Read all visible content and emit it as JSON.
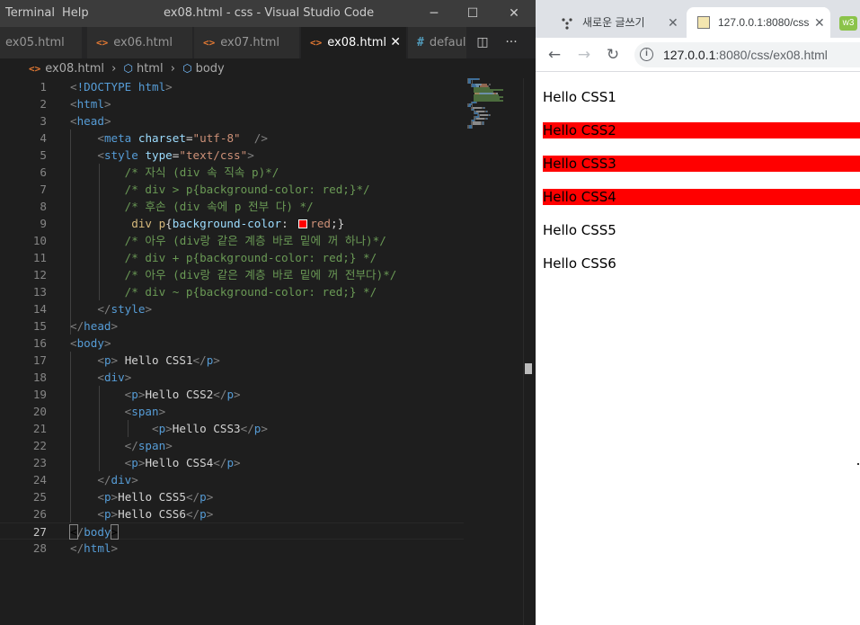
{
  "titlebar": {
    "menu": [
      "Terminal",
      "Help"
    ],
    "title": "ex08.html - css - Visual Studio Code",
    "controls": [
      "─",
      "☐",
      "✕"
    ]
  },
  "tabs": [
    {
      "icon": "<>",
      "label": "ex05.html",
      "active": false
    },
    {
      "icon": "<>",
      "label": "ex06.html",
      "active": false
    },
    {
      "icon": "<>",
      "label": "ex07.html",
      "active": false
    },
    {
      "icon": "<>",
      "label": "ex08.html",
      "active": true,
      "close": "✕"
    },
    {
      "icon": "#",
      "label": "defaul",
      "active": false
    }
  ],
  "tab_actions": [
    "◫",
    "···"
  ],
  "breadcrumb": {
    "file": "ex08.html",
    "items": [
      "html",
      "body"
    ],
    "separator": "›"
  },
  "editor": {
    "current_line": 27,
    "lines": [
      [
        [
          "t-br",
          "<"
        ],
        [
          "t-tag",
          "!DOCTYPE html"
        ],
        [
          "t-br",
          ">"
        ]
      ],
      [
        [
          "t-br",
          "<"
        ],
        [
          "t-tag",
          "html"
        ],
        [
          "t-br",
          ">"
        ]
      ],
      [
        [
          "t-br",
          "<"
        ],
        [
          "t-tag",
          "head"
        ],
        [
          "t-br",
          ">"
        ]
      ],
      [
        [
          "t-txt",
          "    "
        ],
        [
          "t-br",
          "<"
        ],
        [
          "t-tag",
          "meta "
        ],
        [
          "t-attr",
          "charset"
        ],
        [
          "t-txt",
          "="
        ],
        [
          "t-str",
          "\"utf-8\""
        ],
        [
          "t-txt",
          "  "
        ],
        [
          "t-br",
          "/>"
        ]
      ],
      [
        [
          "t-txt",
          "    "
        ],
        [
          "t-br",
          "<"
        ],
        [
          "t-tag",
          "style "
        ],
        [
          "t-attr",
          "type"
        ],
        [
          "t-txt",
          "="
        ],
        [
          "t-str",
          "\"text/css\""
        ],
        [
          "t-br",
          ">"
        ]
      ],
      [
        [
          "t-txt",
          "        "
        ],
        [
          "t-cmt",
          "/* 자식 (div 속 직속 p)*/"
        ]
      ],
      [
        [
          "t-txt",
          "        "
        ],
        [
          "t-cmt",
          "/* div > p{background-color: red;}*/"
        ]
      ],
      [
        [
          "t-txt",
          "        "
        ],
        [
          "t-cmt",
          "/* 후손 (div 속에 p 전부 다) */"
        ]
      ],
      [
        [
          "t-txt",
          "         "
        ],
        [
          "t-sel",
          "div p"
        ],
        [
          "t-txt",
          "{"
        ],
        [
          "t-prop",
          "background-color"
        ],
        [
          "t-txt",
          ": "
        ],
        [
          "swatch",
          ""
        ],
        [
          "t-val",
          "red"
        ],
        [
          "t-txt",
          ";}"
        ]
      ],
      [
        [
          "t-txt",
          "        "
        ],
        [
          "t-cmt",
          "/* 아우 (div랑 같은 계층 바로 밑에 꺼 하나)*/"
        ]
      ],
      [
        [
          "t-txt",
          "        "
        ],
        [
          "t-cmt",
          "/* div + p{background-color: red;} */"
        ]
      ],
      [
        [
          "t-txt",
          "        "
        ],
        [
          "t-cmt",
          "/* 아우 (div랑 같은 계층 바로 밑에 꺼 전부다)*/"
        ]
      ],
      [
        [
          "t-txt",
          "        "
        ],
        [
          "t-cmt",
          "/* div ~ p{background-color: red;} */"
        ]
      ],
      [
        [
          "t-txt",
          "    "
        ],
        [
          "t-br",
          "</"
        ],
        [
          "t-tag",
          "style"
        ],
        [
          "t-br",
          ">"
        ]
      ],
      [
        [
          "t-br",
          "</"
        ],
        [
          "t-tag",
          "head"
        ],
        [
          "t-br",
          ">"
        ]
      ],
      [
        [
          "t-br",
          "<"
        ],
        [
          "t-tag",
          "body"
        ],
        [
          "t-br",
          ">"
        ]
      ],
      [
        [
          "t-txt",
          "    "
        ],
        [
          "t-br",
          "<"
        ],
        [
          "t-tag",
          "p"
        ],
        [
          "t-br",
          ">"
        ],
        [
          "t-txt",
          " Hello CSS1"
        ],
        [
          "t-br",
          "</"
        ],
        [
          "t-tag",
          "p"
        ],
        [
          "t-br",
          ">"
        ]
      ],
      [
        [
          "t-txt",
          "    "
        ],
        [
          "t-br",
          "<"
        ],
        [
          "t-tag",
          "div"
        ],
        [
          "t-br",
          ">"
        ]
      ],
      [
        [
          "t-txt",
          "        "
        ],
        [
          "t-br",
          "<"
        ],
        [
          "t-tag",
          "p"
        ],
        [
          "t-br",
          ">"
        ],
        [
          "t-txt",
          "Hello CSS2"
        ],
        [
          "t-br",
          "</"
        ],
        [
          "t-tag",
          "p"
        ],
        [
          "t-br",
          ">"
        ]
      ],
      [
        [
          "t-txt",
          "        "
        ],
        [
          "t-br",
          "<"
        ],
        [
          "t-tag",
          "span"
        ],
        [
          "t-br",
          ">"
        ]
      ],
      [
        [
          "t-txt",
          "            "
        ],
        [
          "t-br",
          "<"
        ],
        [
          "t-tag",
          "p"
        ],
        [
          "t-br",
          ">"
        ],
        [
          "t-txt",
          "Hello CSS3"
        ],
        [
          "t-br",
          "</"
        ],
        [
          "t-tag",
          "p"
        ],
        [
          "t-br",
          ">"
        ]
      ],
      [
        [
          "t-txt",
          "        "
        ],
        [
          "t-br",
          "</"
        ],
        [
          "t-tag",
          "span"
        ],
        [
          "t-br",
          ">"
        ]
      ],
      [
        [
          "t-txt",
          "        "
        ],
        [
          "t-br",
          "<"
        ],
        [
          "t-tag",
          "p"
        ],
        [
          "t-br",
          ">"
        ],
        [
          "t-txt",
          "Hello CSS4"
        ],
        [
          "t-br",
          "</"
        ],
        [
          "t-tag",
          "p"
        ],
        [
          "t-br",
          ">"
        ]
      ],
      [
        [
          "t-txt",
          "    "
        ],
        [
          "t-br",
          "</"
        ],
        [
          "t-tag",
          "div"
        ],
        [
          "t-br",
          ">"
        ]
      ],
      [
        [
          "t-txt",
          "    "
        ],
        [
          "t-br",
          "<"
        ],
        [
          "t-tag",
          "p"
        ],
        [
          "t-br",
          ">"
        ],
        [
          "t-txt",
          "Hello CSS5"
        ],
        [
          "t-br",
          "</"
        ],
        [
          "t-tag",
          "p"
        ],
        [
          "t-br",
          ">"
        ]
      ],
      [
        [
          "t-txt",
          "    "
        ],
        [
          "t-br",
          "<"
        ],
        [
          "t-tag",
          "p"
        ],
        [
          "t-br",
          ">"
        ],
        [
          "t-txt",
          "Hello CSS6"
        ],
        [
          "t-br",
          "</"
        ],
        [
          "t-tag",
          "p"
        ],
        [
          "t-br",
          ">"
        ]
      ],
      [
        [
          "t-bm",
          "<"
        ],
        [
          "t-br",
          "/"
        ],
        [
          "t-tag",
          "body"
        ],
        [
          "t-bm",
          ">"
        ]
      ],
      [
        [
          "t-br",
          "</"
        ],
        [
          "t-tag",
          "html"
        ],
        [
          "t-br",
          ">"
        ]
      ]
    ]
  },
  "browser": {
    "tabs": [
      {
        "label": "새로운 글쓰기",
        "active": false,
        "close": "✕"
      },
      {
        "label": "127.0.0.1:8080/css",
        "active": true,
        "close": "✕"
      }
    ],
    "extension_label": "w3",
    "nav": {
      "back": "←",
      "forward": "→",
      "reload": "↻"
    },
    "url": {
      "info": "i",
      "host": "127.0.0.1",
      "path": ":8080/css/ex08.html"
    },
    "page": {
      "paragraphs": [
        {
          "text": "Hello CSS1",
          "highlighted": false
        },
        {
          "text": "Hello CSS2",
          "highlighted": true
        },
        {
          "text": "Hello CSS3",
          "highlighted": true
        },
        {
          "text": "Hello CSS4",
          "highlighted": true
        },
        {
          "text": "Hello CSS5",
          "highlighted": false
        },
        {
          "text": "Hello CSS6",
          "highlighted": false
        }
      ],
      "highlight_color": "#ff0000"
    }
  }
}
